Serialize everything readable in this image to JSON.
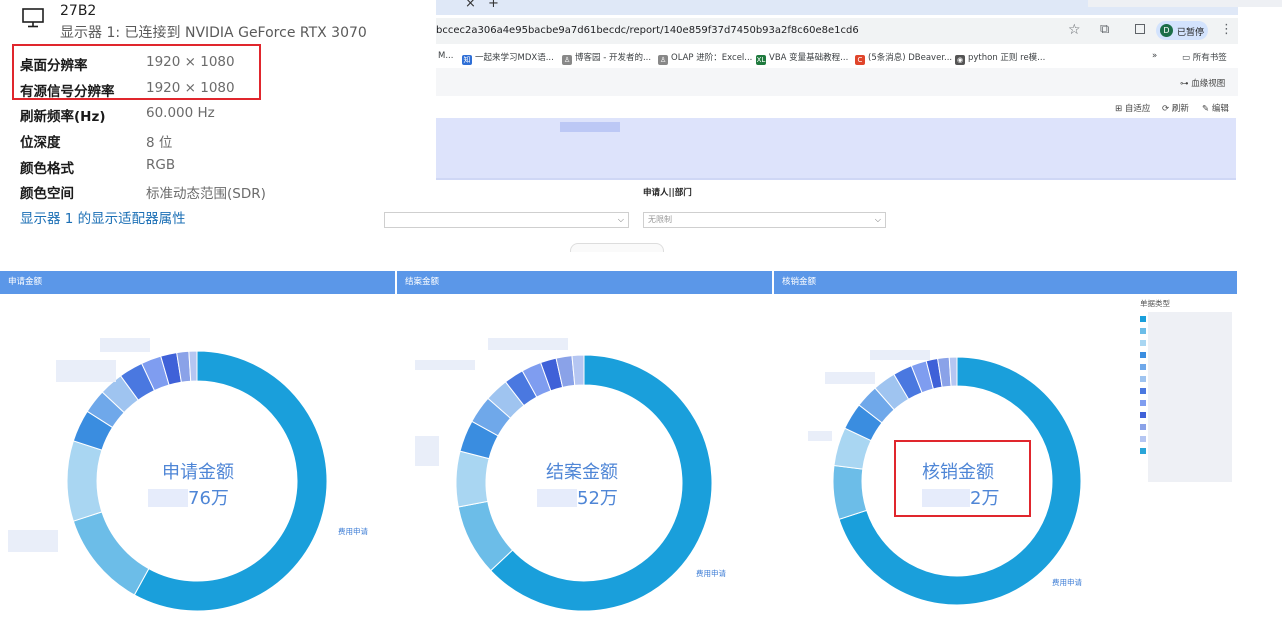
{
  "display_panel": {
    "monitor_name": "27B2",
    "monitor_desc": "显示器 1: 已连接到 NVIDIA GeForce RTX 3070",
    "properties": [
      {
        "label": "桌面分辨率",
        "value": "1920 × 1080"
      },
      {
        "label": "有源信号分辨率",
        "value": "1920 × 1080"
      },
      {
        "label": "刷新频率(Hz)",
        "value": "60.000 Hz"
      },
      {
        "label": "位深度",
        "value": "8 位"
      },
      {
        "label": "颜色格式",
        "value": "RGB"
      },
      {
        "label": "颜色空间",
        "value": "标准动态范围(SDR)"
      }
    ],
    "adapter_link": "显示器 1 的显示适配器属性"
  },
  "browser": {
    "tab_close": "×",
    "tab_new": "+",
    "url": "bccec2a306a4e95bacbe9a7d61becdc/report/140e859f37d7450b93a2f8c60e8e1cd6",
    "profile_initial": "D",
    "profile_label": "已暂停",
    "bookmarks": [
      {
        "label": "M...",
        "icon_color": "",
        "icon_text": ""
      },
      {
        "label": "一起来学习MDX语...",
        "icon_color": "#2f6fd6",
        "icon_text": "知"
      },
      {
        "label": "博客园 - 开发者的...",
        "icon_color": "#888888",
        "icon_text": "♙"
      },
      {
        "label": "OLAP 进阶：Excel...",
        "icon_color": "#888888",
        "icon_text": "♙"
      },
      {
        "label": "VBA 变量基础教程...",
        "icon_color": "#1f7a3e",
        "icon_text": "XL"
      },
      {
        "label": "(5条消息) DBeaver...",
        "icon_color": "#e0452b",
        "icon_text": "C"
      },
      {
        "label": "python 正则 re模...",
        "icon_color": "#555555",
        "icon_text": "◉"
      }
    ],
    "more_bookmarks": "»",
    "all_bookmarks": "所有书签"
  },
  "report": {
    "lineage_label": "血缘视图",
    "tools": [
      "自适应",
      "刷新",
      "编辑"
    ],
    "filter_label": "申请人||部门",
    "filter_placeholder": "无限制",
    "panels": [
      {
        "header": "申请金额",
        "center_title": "申请金额",
        "center_value_suffix": "76万",
        "slice_label": "费用申请"
      },
      {
        "header": "结案金额",
        "center_title": "结案金额",
        "center_value_suffix": "52万",
        "slice_label": "费用申请"
      },
      {
        "header": "核销金额",
        "center_title": "核销金额",
        "center_value_suffix": "2万",
        "slice_label": "费用申请"
      }
    ],
    "legend_title": "单据类型"
  },
  "colors": {
    "accent": "#5b97e8",
    "donut_main": "#1a9fdb",
    "highlight": "#e0262d"
  }
}
